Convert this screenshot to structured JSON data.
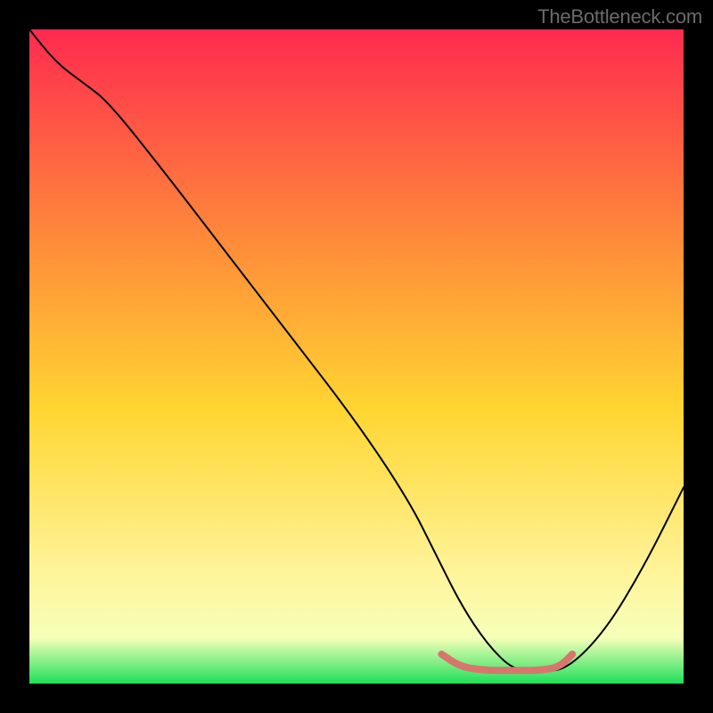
{
  "watermark": "TheBottleneck.com",
  "chart_data": {
    "type": "line",
    "title": "",
    "xlabel": "",
    "ylabel": "",
    "xlim": [
      0,
      100
    ],
    "ylim": [
      0,
      100
    ],
    "background_gradient": {
      "top": "#ff2a4f",
      "mid_upper": "#ff8a3a",
      "mid": "#ffd531",
      "mid_lower": "#fff49a",
      "low": "#f6ffb8",
      "bottom": "#1fe05a"
    },
    "series": [
      {
        "name": "bottleneck-curve",
        "color": "#000000",
        "stroke_width": 2,
        "x": [
          0,
          4,
          8,
          12,
          20,
          30,
          40,
          50,
          58,
          62,
          66,
          70,
          74,
          78,
          82,
          88,
          94,
          100
        ],
        "y": [
          100,
          95,
          92,
          89,
          79,
          66,
          53,
          40,
          28,
          20,
          12,
          6,
          2,
          2,
          2,
          8,
          18,
          30
        ]
      },
      {
        "name": "minimum-band",
        "color": "#d8766e",
        "stroke_width": 8,
        "x": [
          63,
          66,
          70,
          74,
          78,
          81,
          83
        ],
        "y": [
          4.5,
          2.5,
          2,
          2,
          2,
          2.5,
          4.5
        ]
      }
    ]
  }
}
